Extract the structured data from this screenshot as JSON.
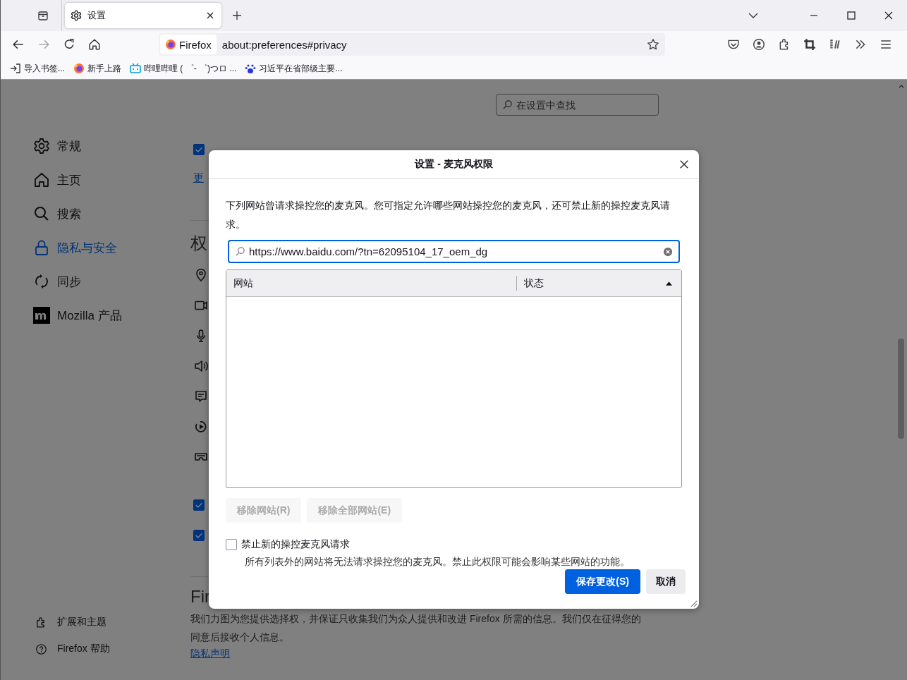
{
  "tabs": [
    {
      "label": "设置",
      "selected": true
    }
  ],
  "address": {
    "identity": "Firefox",
    "url": "about:preferences#privacy"
  },
  "bookmarks": [
    {
      "label": "导入书签...",
      "kind": "import"
    },
    {
      "label": "新手上路",
      "kind": "fox"
    },
    {
      "label": "哔哩哔哩 ( ゜- ゜)つロ ...",
      "kind": "tv"
    },
    {
      "label": "习近平在省部级主要...",
      "kind": "paw"
    }
  ],
  "sidebar": {
    "items": [
      {
        "label": "常规",
        "kind": "gear",
        "selected": false
      },
      {
        "label": "主页",
        "kind": "home",
        "selected": false
      },
      {
        "label": "搜索",
        "kind": "search",
        "selected": false
      },
      {
        "label": "隐私与安全",
        "kind": "lock",
        "selected": true
      },
      {
        "label": "同步",
        "kind": "sync",
        "selected": false
      },
      {
        "label": "Mozilla 产品",
        "kind": "mozilla",
        "selected": false
      }
    ],
    "footer": [
      {
        "label": "扩展和主题",
        "kind": "puzzle"
      },
      {
        "label": "Firefox 帮助",
        "kind": "help"
      }
    ]
  },
  "page": {
    "search": {
      "placeholder": "在设置中查找"
    },
    "top_checkbox": {
      "checked": true
    },
    "link": "更",
    "heading": "权",
    "lower_checkboxes": [
      {
        "checked": true
      },
      {
        "checked": true
      }
    ],
    "section_heading": "Fir",
    "paragraph": "我们力图为您提供选择权，并保证只收集我们为众人提供和改进 Firefox 所需的信息。我们仅在征得您的同意后接收个人信息。",
    "privacy_link": "隐私声明"
  },
  "dialog": {
    "title": "设置 - 麦克风权限",
    "description": "下列网站曾请求操控您的麦克风。您可指定允许哪些网站操控您的麦克风，还可禁止新的操控麦克风请求。",
    "search": {
      "value": "https://www.baidu.com/?tn=62095104_17_oem_dg"
    },
    "columns": [
      {
        "label": "网站",
        "sorted": false
      },
      {
        "label": "状态",
        "sorted": true
      }
    ],
    "remove_buttons": [
      {
        "label": "移除网站(R)",
        "disabled": true
      },
      {
        "label": "移除全部网站(E)",
        "disabled": true
      }
    ],
    "block": {
      "label": "禁止新的操控麦克风请求",
      "checked": false
    },
    "note": "所有列表外的网站将无法请求操控您的麦克风。禁止此权限可能会影响某些网站的功能。",
    "save": "保存更改(S)",
    "cancel": "取消"
  }
}
